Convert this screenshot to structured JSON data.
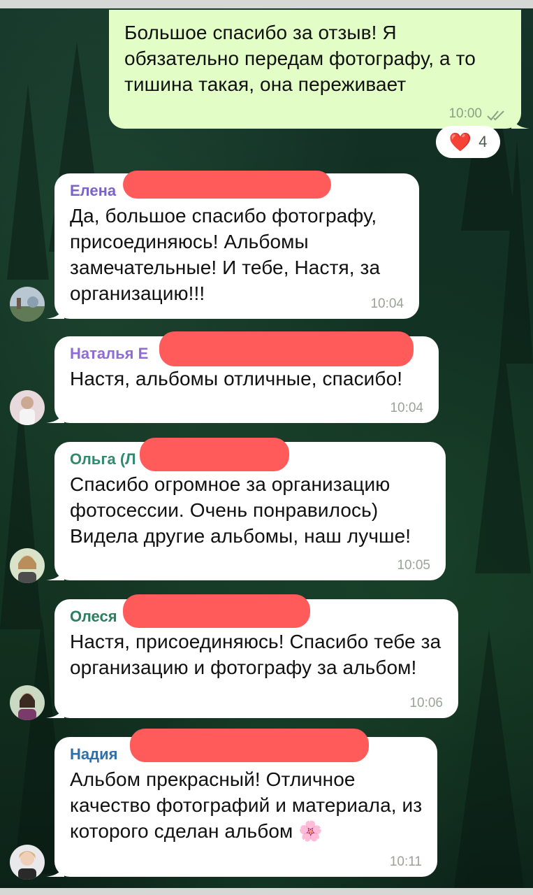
{
  "outgoing": {
    "text": "Большое спасибо за отзыв! Я обязательно передам фотографу, а то тишина такая, она переживает",
    "time": "10:00",
    "reaction": {
      "emoji": "❤️",
      "count": "4"
    }
  },
  "messages": [
    {
      "sender": "Елена",
      "text": "Да, большое спасибо фотографу, присоединяюсь! Альбомы замечательные! И тебе, Настя, за организацию!!!",
      "time": "10:04",
      "sender_color": "#7b63c9"
    },
    {
      "sender": "Наталья Е",
      "text": "Настя, альбомы отличные, спасибо!",
      "time": "10:04",
      "sender_color": "#8f6bd6"
    },
    {
      "sender": "Ольга (Л",
      "text": "Спасибо огромное за организацию фотосессии. Очень понравилось) Видела другие альбомы, наш лучше!",
      "time": "10:05",
      "sender_color": "#2f8a6e"
    },
    {
      "sender": "Олеся",
      "text": "Настя, присоединяюсь! Спасибо тебе за организацию и фотографу за альбом!",
      "time": "10:06",
      "sender_color": "#2a7f5e"
    },
    {
      "sender": "Надия",
      "text": "Альбом прекрасный! Отличное качество фотографий и материала, из которого сделан альбом 🌸",
      "time": "10:11",
      "sender_color": "#2d6fa8"
    }
  ],
  "colors": {
    "outgoing_bubble": "#e2fdc6",
    "incoming_bubble": "#ffffff",
    "redaction": "#ff5b5b"
  }
}
